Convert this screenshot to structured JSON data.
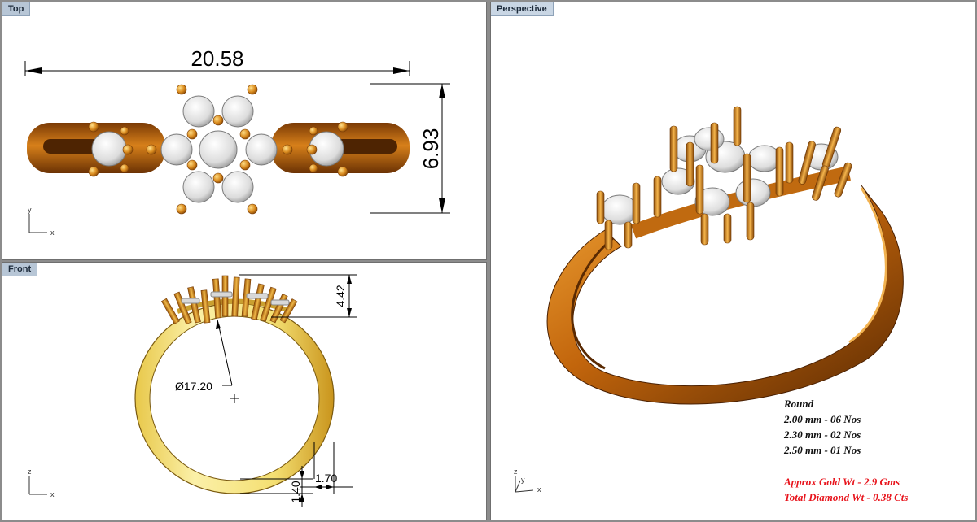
{
  "viewports": {
    "top": {
      "title": "Top",
      "dimension_width": "20.58",
      "dimension_height": "6.93",
      "axis_h": "x",
      "axis_v": "y"
    },
    "front": {
      "title": "Front",
      "dimension_height": "4.42",
      "diameter": "Ø17.20",
      "dim_bottom_a": "1.70",
      "dim_bottom_b": "1.40",
      "axis_h": "x",
      "axis_v": "z"
    },
    "perspective": {
      "title": "Perspective",
      "axis_h": "x",
      "axis_v": "z",
      "axis_y": "y"
    }
  },
  "specs": {
    "heading": "Round",
    "lines": [
      "2.00 mm - 06 Nos",
      "2.30 mm - 02 Nos",
      "2.50 mm - 01 Nos"
    ],
    "gold_weight": "Approx Gold Wt - 2.9 Gms",
    "diamond_weight": "Total Diamond Wt - 0.38 Cts"
  },
  "colors": {
    "gold": "#c9720f",
    "gold_light": "#f2d65e",
    "gold_dark": "#7a3a05",
    "diamond": "#e4e4e4",
    "spec_red": "#e8141c",
    "tab_bg": "#b7c6d6"
  }
}
